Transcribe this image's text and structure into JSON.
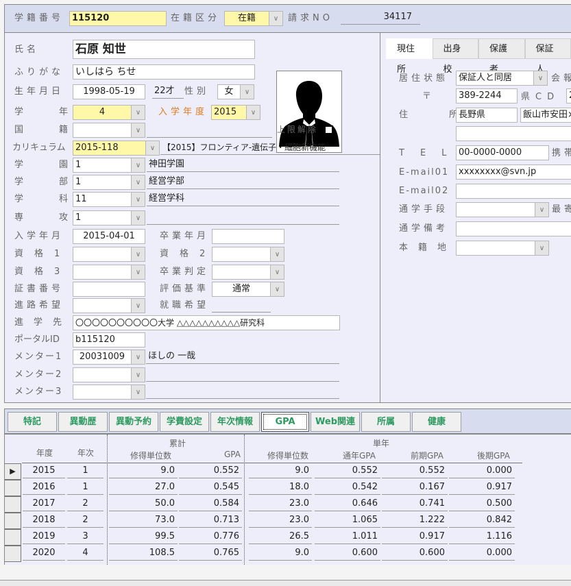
{
  "header": {
    "student_no_label": "学籍番号",
    "student_no": "115120",
    "enroll_status_label": "在籍区分",
    "enroll_status": "在籍",
    "invoice_no_label": "請求NO",
    "invoice_no": "34117"
  },
  "profile": {
    "name_label": "氏名",
    "name": "石原 知世",
    "kana_label": "ふりがな",
    "kana": "いしはら ちせ",
    "birthdate_label": "生年月日",
    "birthdate": "1998-05-19",
    "age": "22才",
    "gender_label": "性別",
    "gender": "女",
    "grade_label": "学年",
    "grade": "4",
    "entry_year_label": "入学年度",
    "entry_year": "2015",
    "nationality_label": "国籍",
    "nationality": "",
    "limit_release_label": "上限解除",
    "limit_release_checked": false,
    "curriculum_label": "カリキュラム",
    "curriculum": "2015-118",
    "curriculum_name": "【2015】フロンティア-遺伝子・細胞新機能",
    "campus_label": "学園",
    "campus": "1",
    "campus_name": "神田学園",
    "faculty_label": "学部",
    "faculty": "1",
    "faculty_name": "経営学部",
    "department_label": "学科",
    "department": "11",
    "department_name": "経営学科",
    "major_label": "専攻",
    "major": "1",
    "major_name": "",
    "entry_date_label": "入学年月",
    "entry_date": "2015-04-01",
    "grad_date_label": "卒業年月",
    "grad_date": "",
    "qual1_label": "資格1",
    "qual1": "",
    "qual2_label": "資格2",
    "qual2": "",
    "qual3_label": "資格3",
    "qual3": "",
    "grad_judge_label": "卒業判定",
    "grad_judge": "",
    "cert_no_label": "証書番号",
    "cert_no": "",
    "eval_std_label": "評価基準",
    "eval_std": "通常",
    "career_label": "進路希望",
    "career": "",
    "job_label": "就職希望",
    "job": "",
    "next_school_label": "進学先",
    "next_school": "〇〇〇〇〇〇〇〇〇〇大学 △△△△△△△△△△研究科",
    "portal_label": "ポータルID",
    "portal_id": "b115120",
    "mentor1_label": "メンター1",
    "mentor1": "20031009",
    "mentor1_name": "ほしの 一哉",
    "mentor2_label": "メンター2",
    "mentor2": "",
    "mentor3_label": "メンター3",
    "mentor3": ""
  },
  "address_tabs": [
    {
      "label": "現住所",
      "active": true
    },
    {
      "label": "出身校",
      "active": false
    },
    {
      "label": "保護者",
      "active": false
    },
    {
      "label": "保証人",
      "active": false
    }
  ],
  "address": {
    "residence_label": "居住状態",
    "residence": "保証人と同居",
    "report_label": "会報",
    "postal_label": "〒",
    "postal": "389-2244",
    "pref_cd_label": "県CD",
    "pref_cd": "2",
    "address_label": "住所",
    "pref": "長野県",
    "city": "飯山市安田×",
    "address2": "",
    "tel_label": "TEL",
    "tel": "00-0000-0000",
    "mobile_label": "携帯",
    "email1_label": "E-mail01",
    "email1": "xxxxxxxx@svn.jp",
    "email2_label": "E-mail02",
    "email2": "",
    "commute_label": "通学手段",
    "commute": "",
    "nearest_label": "最寄",
    "commute_note_label": "通学備考",
    "commute_note": "",
    "domicile_label": "本籍地",
    "domicile": ""
  },
  "buttons": [
    {
      "label": "特記",
      "active": false
    },
    {
      "label": "異動歴",
      "active": false
    },
    {
      "label": "異動予約",
      "active": false
    },
    {
      "label": "学費設定",
      "active": false
    },
    {
      "label": "年次情報",
      "active": false
    },
    {
      "label": "GPA",
      "active": true
    },
    {
      "label": "Web関連",
      "active": false
    },
    {
      "label": "所属",
      "active": false
    },
    {
      "label": "健康",
      "active": false
    }
  ],
  "gpa_table": {
    "group_cumulative": "累計",
    "group_single": "単年",
    "columns": [
      "年度",
      "年次",
      "修得単位数",
      "GPA",
      "修得単位数",
      "通年GPA",
      "前期GPA",
      "後期GPA"
    ],
    "rows": [
      [
        "2015",
        "1",
        "9.0",
        "0.552",
        "9.0",
        "0.552",
        "0.552",
        "0.000"
      ],
      [
        "2016",
        "1",
        "27.0",
        "0.545",
        "18.0",
        "0.542",
        "0.167",
        "0.917"
      ],
      [
        "2017",
        "2",
        "50.0",
        "0.584",
        "23.0",
        "0.646",
        "0.741",
        "0.500"
      ],
      [
        "2018",
        "2",
        "73.0",
        "0.713",
        "23.0",
        "1.065",
        "1.222",
        "0.842"
      ],
      [
        "2019",
        "3",
        "99.5",
        "0.776",
        "26.5",
        "1.011",
        "0.917",
        "1.116"
      ],
      [
        "2020",
        "4",
        "108.5",
        "0.765",
        "9.0",
        "0.600",
        "0.600",
        "0.000"
      ]
    ],
    "current_row": 0
  }
}
